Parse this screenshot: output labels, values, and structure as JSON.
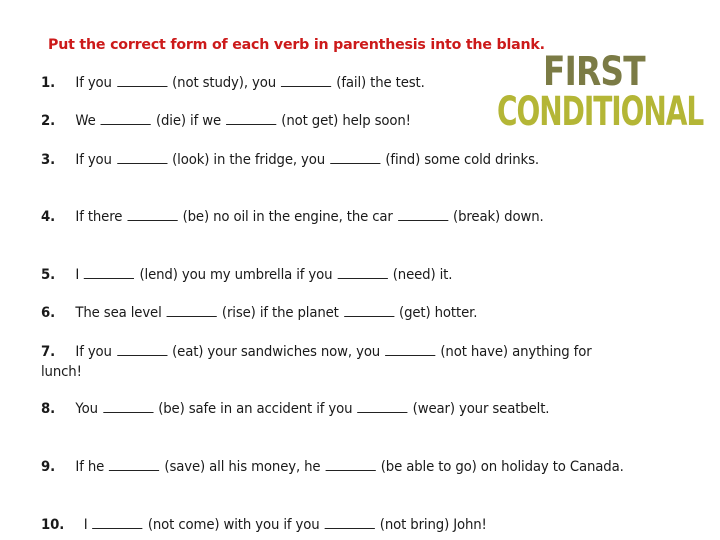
{
  "header": {
    "instruction": "Put the correct form of each verb in parenthesis into the blank."
  },
  "logo": {
    "line1": "FIRST",
    "line2": "CONDITIONAL",
    "colors": {
      "first": "#7b7b45",
      "conditional": "#b4b636"
    }
  },
  "colors": {
    "instruction": "#cc1a1a",
    "text": "#1a1a1a"
  },
  "exercises": [
    {
      "num": "1.",
      "before": "If you",
      "mid": "(not study), you",
      "after": "(fail) the test."
    },
    {
      "num": "2.",
      "before": "We",
      "mid": "(die) if we",
      "after": "(not get) help soon!"
    },
    {
      "num": "3.",
      "before": "If you",
      "mid": "(look) in the fridge, you",
      "after": "(find) some cold drinks."
    },
    {
      "num": "4.",
      "before": "If there",
      "mid": "(be) no oil in the engine, the car",
      "after": "(break) down."
    },
    {
      "num": "5.",
      "before": "I",
      "mid": "(lend) you my umbrella if you",
      "after": "(need) it."
    },
    {
      "num": "6.",
      "before": "The sea level",
      "mid": "(rise) if the planet",
      "after": "(get) hotter."
    },
    {
      "num": "7.",
      "before": "If you",
      "mid": "(eat) your sandwiches now, you",
      "after": "(not have) anything for lunch!"
    },
    {
      "num": "8.",
      "before": "You",
      "mid": "(be) safe in an accident if you",
      "after": "(wear) your seatbelt."
    },
    {
      "num": "9.",
      "before": "If he",
      "mid": "(save) all his money, he",
      "after": "(be able to go) on holiday to Canada."
    },
    {
      "num": "10.",
      "before": "I",
      "mid": "(not come) with you if you",
      "after": "(not bring) John!"
    }
  ]
}
